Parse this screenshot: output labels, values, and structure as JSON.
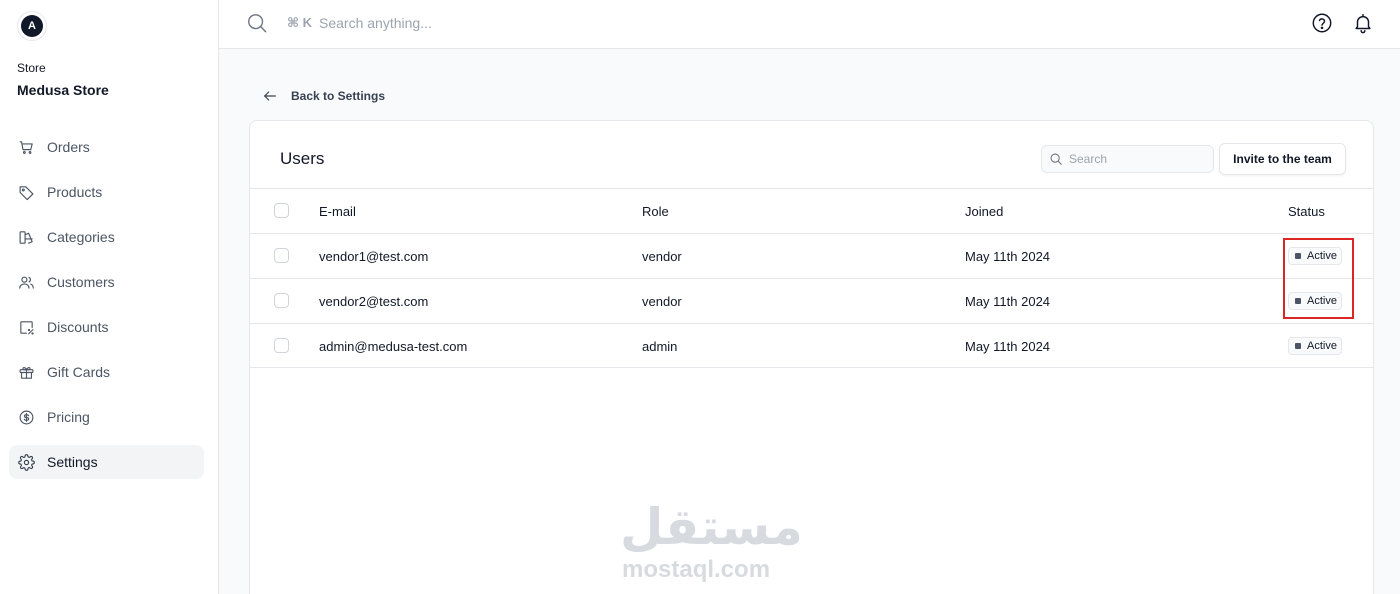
{
  "store": {
    "avatar_letter": "A",
    "label": "Store",
    "name": "Medusa Store"
  },
  "sidebar": {
    "items": [
      {
        "label": "Orders",
        "icon": "cart-icon",
        "active": false
      },
      {
        "label": "Products",
        "icon": "tag-icon",
        "active": false
      },
      {
        "label": "Categories",
        "icon": "categories-icon",
        "active": false
      },
      {
        "label": "Customers",
        "icon": "users-icon",
        "active": false
      },
      {
        "label": "Discounts",
        "icon": "discount-icon",
        "active": false
      },
      {
        "label": "Gift Cards",
        "icon": "gift-icon",
        "active": false
      },
      {
        "label": "Pricing",
        "icon": "dollar-icon",
        "active": false
      },
      {
        "label": "Settings",
        "icon": "gear-icon",
        "active": true
      }
    ]
  },
  "topbar": {
    "shortcut": "⌘ K",
    "search_placeholder": "Search anything..."
  },
  "back_link": "Back to Settings",
  "card": {
    "title": "Users",
    "search_placeholder": "Search",
    "invite_label": "Invite to the team"
  },
  "table": {
    "headers": {
      "email": "E-mail",
      "role": "Role",
      "joined": "Joined",
      "status": "Status"
    },
    "rows": [
      {
        "email": "vendor1@test.com",
        "role": "vendor",
        "joined": "May 11th 2024",
        "status": "Active"
      },
      {
        "email": "vendor2@test.com",
        "role": "vendor",
        "joined": "May 11th 2024",
        "status": "Active"
      },
      {
        "email": "admin@medusa-test.com",
        "role": "admin",
        "joined": "May 11th 2024",
        "status": "Active"
      }
    ]
  },
  "watermark": {
    "arabic": "مستقل",
    "latin": "mostaql.com"
  },
  "colors": {
    "highlight": "#dc2626",
    "active_nav_bg": "#f3f4f6",
    "status_dot": "#4b5563"
  }
}
